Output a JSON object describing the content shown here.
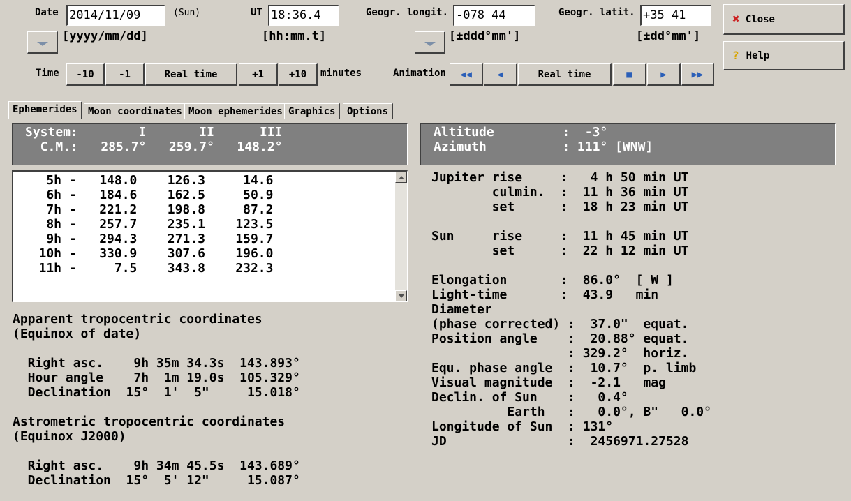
{
  "header": {
    "date_label": "Date",
    "date_value": "2014/11/09",
    "weekday": "(Sun)",
    "date_format": "[yyyy/mm/dd]",
    "ut_label": "UT",
    "ut_value": "18:36.4",
    "ut_format": "[hh:mm.t]",
    "longit_label": "Geogr. longit.",
    "longit_value": "-078 44",
    "longit_format": "[±ddd°mm']",
    "latit_label": "Geogr. latit.",
    "latit_value": "+35 41",
    "latit_format": "[±dd°mm']"
  },
  "side_buttons": {
    "close": "Close",
    "help": "Help"
  },
  "time_controls": {
    "label": "Time",
    "minus10": "-10",
    "minus1": "-1",
    "realtime": "Real time",
    "plus1": "+1",
    "plus10": "+10",
    "unit": "minutes"
  },
  "animation": {
    "label": "Animation",
    "realtime": "Real time"
  },
  "icons": {
    "close": "close-icon",
    "help": "help-icon",
    "dropdown": "chevron-down-icon",
    "fast_back": "fast-rewind-icon",
    "back": "step-back-icon",
    "stop": "stop-icon",
    "forward": "step-forward-icon",
    "fast_forward": "fast-forward-icon"
  },
  "colors": {
    "background": "#d4d0c8",
    "panel": "#808080",
    "accent_icon": "#2b5fb8",
    "close_x": "#cc2222"
  },
  "tabs": [
    "Ephemerides",
    "Moon coordinates",
    "Moon ephemerides",
    "Graphics",
    "Options"
  ],
  "cm_panel": {
    "line1": "System:        I       II      III",
    "line2": "  C.M.:   285.7°   259.7°   148.2°"
  },
  "cm_table": [
    "    5h -   148.0    126.3     14.6",
    "    6h -   184.6    162.5     50.9",
    "    7h -   221.2    198.8     87.2",
    "    8h -   257.7    235.1    123.5",
    "    9h -   294.3    271.3    159.7",
    "   10h -   330.9    307.6    196.0",
    "   11h -     7.5    343.8    232.3"
  ],
  "apparent": {
    "title1": "Apparent tropocentric coordinates",
    "title2": "(Equinox of date)",
    "lines": [
      "  Right asc.    9h 35m 34.3s  143.893°",
      "  Hour angle    7h  1m 19.0s  105.329°",
      "  Declination  15°  1'  5\"     15.018°"
    ]
  },
  "astrometric": {
    "title1": "Astrometric tropocentric coordinates",
    "title2": "(Equinox J2000)",
    "lines": [
      "  Right asc.    9h 34m 45.5s  143.689°",
      "  Declination  15°  5' 12\"     15.087°"
    ]
  },
  "altaz_panel": {
    "line1": "Altitude         :  -3°",
    "line2": "Azimuth          : 111° [WNW]"
  },
  "info_lines": [
    "Jupiter rise     :   4 h 50 min UT",
    "        culmin.  :  11 h 36 min UT",
    "        set      :  18 h 23 min UT",
    "",
    "Sun     rise     :  11 h 45 min UT",
    "        set      :  22 h 12 min UT",
    "",
    "Elongation       :  86.0°  [ W ]",
    "Light-time       :  43.9   min",
    "Diameter",
    "(phase corrected) :  37.0\"  equat.",
    "Position angle    :  20.88° equat.",
    "                  : 329.2°  horiz.",
    "Equ. phase angle  :  10.7°  p. limb",
    "Visual magnitude  :  -2.1   mag",
    "Declin. of Sun    :   0.4°",
    "          Earth   :   0.0°, B\"   0.0°",
    "Longitude of Sun  : 131°",
    "JD                :  2456971.27528"
  ]
}
